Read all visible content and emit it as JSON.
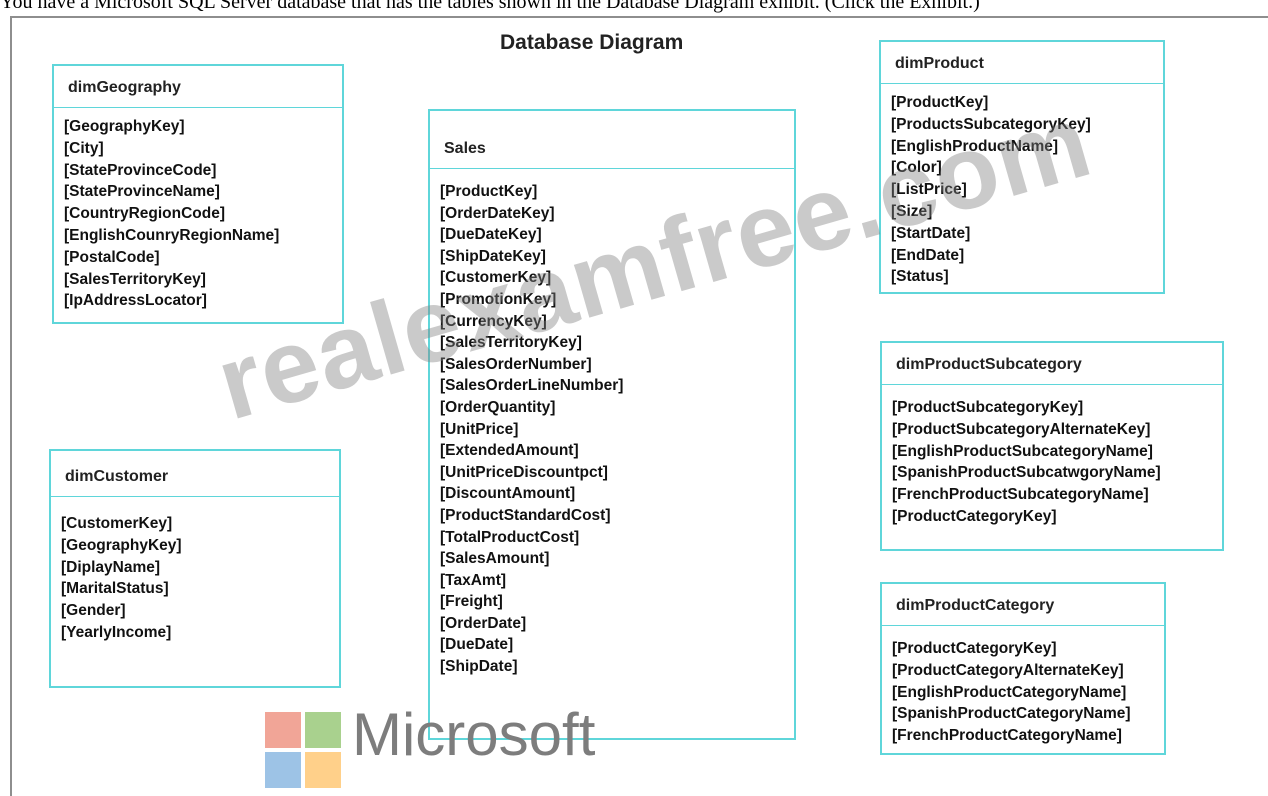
{
  "intro_text": "You have a Microsoft SQL Server database that has the tables shown in the Database Diagram exhibit. (Click the Exhibit.)",
  "diagram_title": "Database Diagram",
  "watermark_text": "realexamfree.com",
  "logo": {
    "text": "Microsoft",
    "colors": {
      "red": "#f1a597",
      "green": "#a9d18e",
      "blue": "#9dc3e6",
      "yellow": "#ffd08a"
    }
  },
  "accent_color": "#5fd6da",
  "tables": {
    "dimGeography": {
      "name": "dimGeography",
      "columns": [
        "[GeographyKey]",
        "[City]",
        "[StateProvinceCode]",
        "[StateProvinceName]",
        "[CountryRegionCode]",
        "[EnglishCounryRegionName]",
        "[PostalCode]",
        "[SalesTerritoryKey]",
        "[IpAddressLocator]"
      ]
    },
    "sales": {
      "name": "Sales",
      "columns": [
        "[ProductKey]",
        "[OrderDateKey]",
        "[DueDateKey]",
        "[ShipDateKey]",
        "[CustomerKey]",
        "[PromotionKey]",
        "[CurrencyKey]",
        "[SalesTerritoryKey]",
        "[SalesOrderNumber]",
        "[SalesOrderLineNumber]",
        "[OrderQuantity]",
        "[UnitPrice]",
        "[ExtendedAmount]",
        "[UnitPriceDiscountpct]",
        "[DiscountAmount]",
        "[ProductStandardCost]",
        "[TotalProductCost]",
        "[SalesAmount]",
        "[TaxAmt]",
        "[Freight]",
        "[OrderDate]",
        "[DueDate]",
        "[ShipDate]"
      ]
    },
    "dimProduct": {
      "name": "dimProduct",
      "columns": [
        "[ProductKey]",
        "[ProductsSubcategoryKey]",
        "[EnglishProductName]",
        "[Color]",
        "[ListPrice]",
        "[Size]",
        "[StartDate]",
        "[EndDate]",
        "[Status]"
      ]
    },
    "dimCustomer": {
      "name": "dimCustomer",
      "columns": [
        "[CustomerKey]",
        "[GeographyKey]",
        "[DiplayName]",
        "[MaritalStatus]",
        "[Gender]",
        "[YearlyIncome]"
      ]
    },
    "dimProductSubcategory": {
      "name": "dimProductSubcategory",
      "columns": [
        "[ProductSubcategoryKey]",
        "[ProductSubcategoryAlternateKey]",
        "[EnglishProductSubcategoryName]",
        "[SpanishProductSubcatwgoryName]",
        "[FrenchProductSubcategoryName]",
        "[ProductCategoryKey]"
      ]
    },
    "dimProductCategory": {
      "name": "dimProductCategory",
      "columns": [
        "[ProductCategoryKey]",
        "[ProductCategoryAlternateKey]",
        "[EnglishProductCategoryName]",
        "[SpanishProductCategoryName]",
        "[FrenchProductCategoryName]"
      ]
    }
  }
}
